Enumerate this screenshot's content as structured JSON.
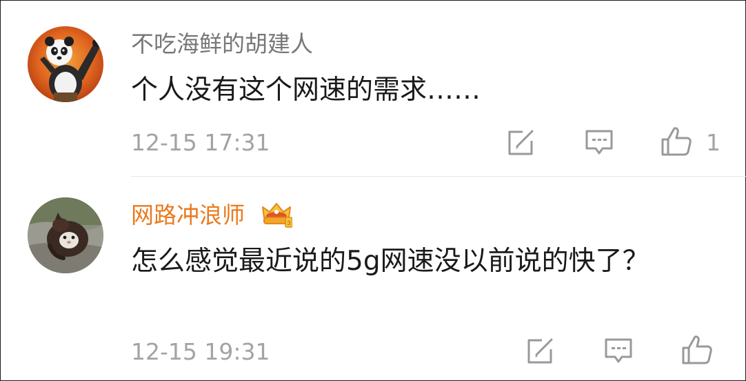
{
  "comments": [
    {
      "username": "不吃海鲜的胡建人",
      "content": "个人没有这个网速的需求……",
      "timestamp": "12-15 17:31",
      "like_count": "1",
      "avatar_icon": "panda-avatar-icon"
    },
    {
      "username": "网路冲浪师",
      "content": "怎么感觉最近说的5g网速没以前说的快了？",
      "timestamp": "12-15 19:31",
      "like_count": "",
      "avatar_icon": "cat-avatar-icon",
      "badge_icon": "vip-crown-icon"
    }
  ],
  "actions": {
    "repost_icon": "repost-icon",
    "reply_icon": "comment-icon",
    "like_icon": "thumbs-up-icon"
  },
  "colors": {
    "username_default": "#777777",
    "username_vip": "#ea7a1e",
    "content": "#1a1a1a",
    "meta": "#a3a3a3",
    "divider": "#e6e6e6"
  }
}
